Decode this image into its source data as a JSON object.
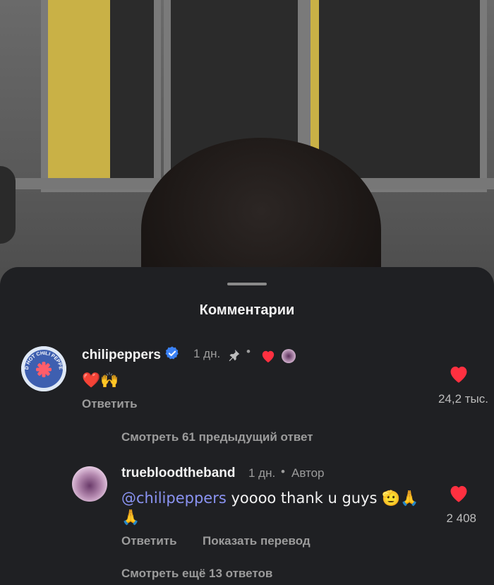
{
  "sheet": {
    "title": "Комментарии"
  },
  "comments": [
    {
      "username": "chilipeppers",
      "verified": true,
      "time": "1 дн.",
      "pinned": true,
      "text": "❤️🙌",
      "reply_label": "Ответить",
      "likes": "24,2 тыс.",
      "view_replies": "Смотреть 61 предыдущий ответ"
    },
    {
      "username": "truebloodtheband",
      "time": "1 дн.",
      "role": "Автор",
      "mention": "@chilipeppers",
      "text": " yoooo thank u guys 🫡🙏",
      "text_line2": "🙏",
      "reply_label": "Ответить",
      "translate_label": "Показать перевод",
      "likes": "2 408",
      "view_more": "Смотреть ещё 13 ответов"
    }
  ],
  "avatar_logo_text": "RED HOT CHILI PEPPERS",
  "colors": {
    "heart": "#ff3040",
    "verified": "#3b82f6",
    "mention": "#8a93f2"
  }
}
